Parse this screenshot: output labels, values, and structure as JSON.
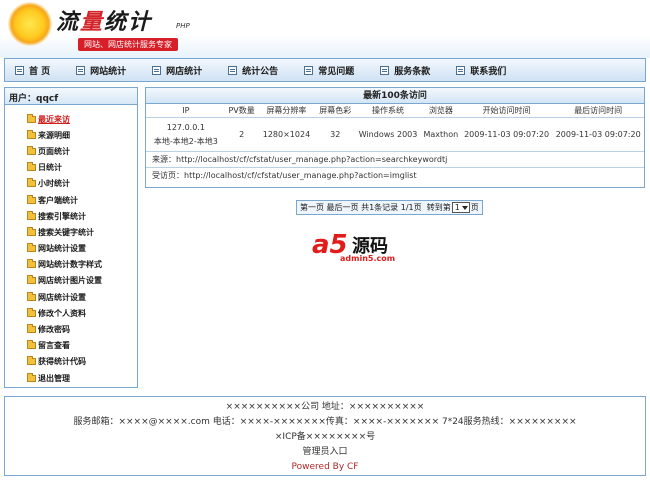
{
  "header": {
    "logo_part1": "流",
    "logo_part2": "量",
    "logo_part3": "统计",
    "logo_php": "PHP",
    "slogan": "网站、网店统计服务专家"
  },
  "nav": [
    {
      "label": "首  页",
      "icon": "home-icon"
    },
    {
      "label": "网站统计",
      "icon": "site-stats-icon"
    },
    {
      "label": "网店统计",
      "icon": "shop-stats-icon"
    },
    {
      "label": "统计公告",
      "icon": "notice-icon"
    },
    {
      "label": "常见问题",
      "icon": "faq-icon"
    },
    {
      "label": "服务条款",
      "icon": "terms-icon"
    },
    {
      "label": "联系我们",
      "icon": "contact-icon"
    }
  ],
  "sidebar": {
    "user_label": "用户：qqcf",
    "items": [
      {
        "label": "最近来访",
        "active": true
      },
      {
        "label": "来源明细"
      },
      {
        "label": "页面统计"
      },
      {
        "label": "日统计"
      },
      {
        "label": "小时统计"
      },
      {
        "label": "客户端统计"
      },
      {
        "label": "搜索引擎统计"
      },
      {
        "label": "搜索关键字统计"
      },
      {
        "label": "网站统计设置"
      },
      {
        "label": "网站统计数字样式"
      },
      {
        "label": "网店统计图片设置"
      },
      {
        "label": "网店统计设置"
      },
      {
        "label": "修改个人资料"
      },
      {
        "label": "修改密码"
      },
      {
        "label": "留言查看"
      },
      {
        "label": "获得统计代码"
      },
      {
        "label": "退出管理"
      }
    ]
  },
  "table": {
    "title": "最新100条访问",
    "headers": [
      "IP",
      "PV数量",
      "屏幕分辨率",
      "屏幕色彩",
      "操作系统",
      "浏览器",
      "开始访问时间",
      "最后访问时间"
    ],
    "row": {
      "ip": "127.0.0.1",
      "location": "本地-本地2-本地3",
      "pv": "2",
      "resolution": "1280×1024",
      "color": "32",
      "os": "Windows 2003",
      "browser": "Maxthon",
      "first_visit": "2009-11-03 09:07:20",
      "last_visit": "2009-11-03 09:07:20"
    },
    "source": "来源：http://localhost/cf/cfstat/user_manage.php?action=searchkeywordtj",
    "visited": "受访页：http://localhost/cf/cfstat/user_manage.php?action=imglist"
  },
  "pagination": {
    "first": "第一页",
    "last": "最后一页",
    "summary": "共1条记录 1/1页",
    "goto": "转到第",
    "page_value": "1",
    "page_suffix": "页"
  },
  "watermark": {
    "brand": "a5",
    "name": "源码",
    "url": "admin5.com"
  },
  "footer": {
    "line1": "××××××××××公司 地址：××××××××××",
    "line2": "服务邮箱：××××@××××.com 电话：××××-×××××××传真：××××-××××××× 7*24服务热线：×××××××××",
    "line3": "×ICP备××××××××号",
    "admin": "管理员入口",
    "powered": "Powered By CF"
  },
  "colors": {
    "accent_border": "#7aa7d0",
    "active_link": "#d11a1a",
    "brand_red": "#d61f29"
  }
}
